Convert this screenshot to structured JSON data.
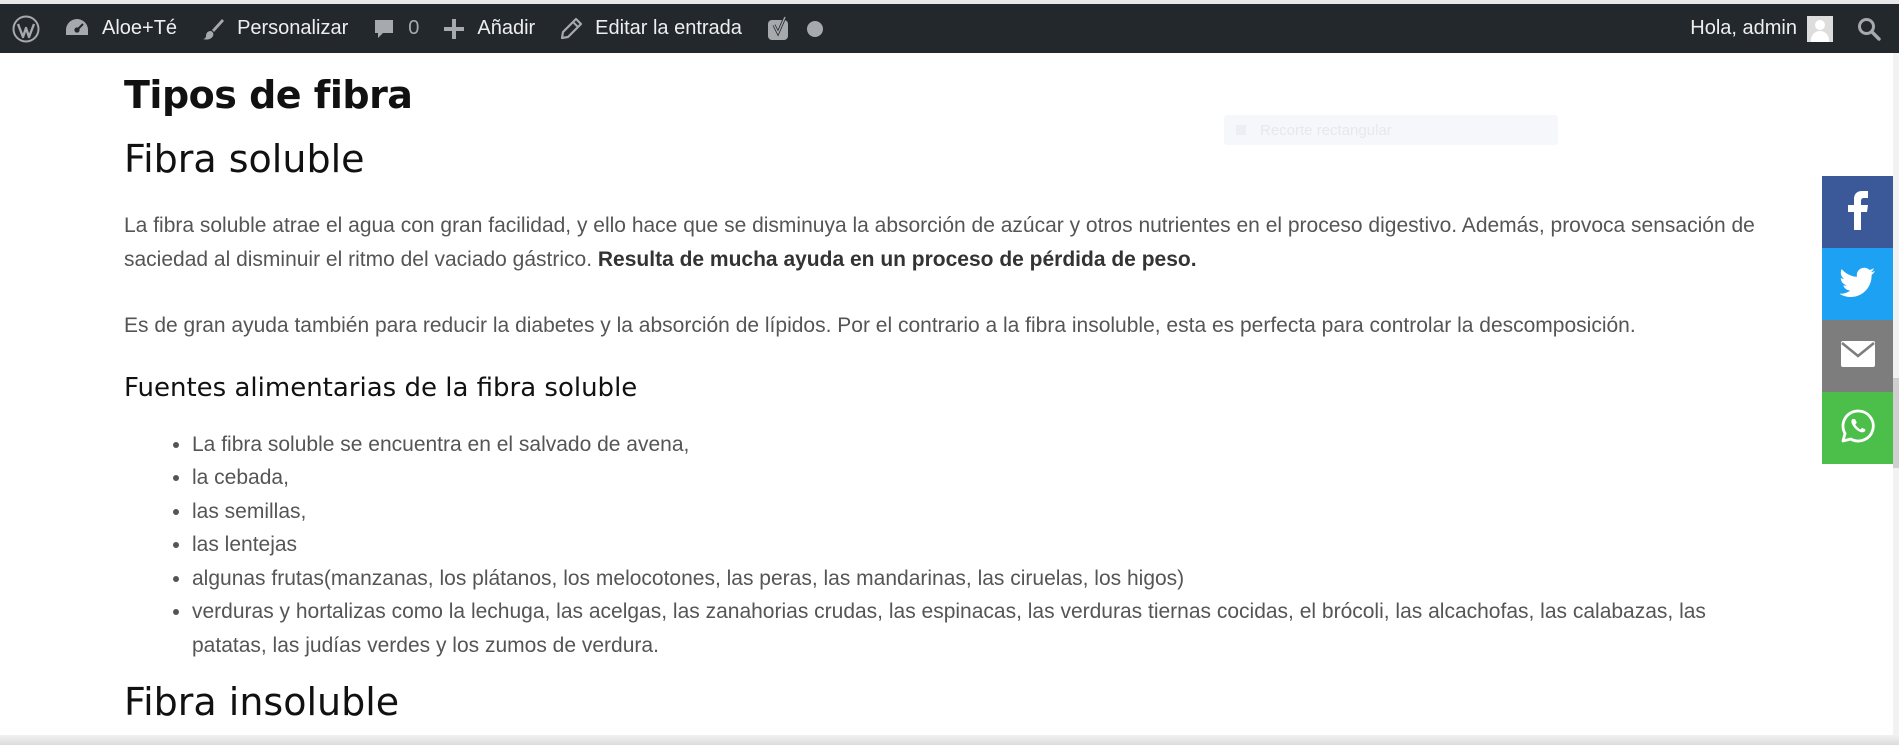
{
  "admin_bar": {
    "site_name": "Aloe+Té",
    "customize": "Personalizar",
    "comments_count": "0",
    "add_new": "Añadir",
    "edit_post": "Editar la entrada",
    "greeting": "Hola, admin",
    "icons": [
      "wordpress-logo-icon",
      "dashboard-icon",
      "brush-icon",
      "comment-icon",
      "plus-icon",
      "pencil-icon",
      "yoast-icon",
      "status-dot-icon",
      "avatar",
      "search-icon"
    ]
  },
  "article": {
    "h_tipos": "Tipos de fibra",
    "h_soluble": "Fibra soluble",
    "p1_text": "La fibra soluble atrae el agua con gran facilidad, y ello hace que se disminuya la absorción de azúcar y otros nutrientes en el proceso digestivo. Además, provoca sensación de saciedad al disminuir el ritmo del vaciado gástrico. ",
    "p1_bold": "Resulta de mucha ayuda en un proceso de pérdida de peso.",
    "p2": "Es de gran ayuda también para reducir la diabetes y la absorción de lípidos. Por el contrario a la fibra insoluble, esta es perfecta para controlar la descomposición.",
    "h_fuentes": "Fuentes alimentarias de la fibra soluble",
    "list": [
      "La fibra soluble se encuentra en el salvado de avena,",
      "la cebada,",
      "las semillas,",
      "las lentejas",
      "algunas frutas(manzanas, los plátanos, los melocotones, las peras, las mandarinas, las ciruelas, los higos)",
      "verduras y hortalizas como la lechuga, las acelgas, las zanahorias crudas, las espinacas, las verduras tiernas cocidas, el brócoli, las alcachofas, las calabazas, las patatas, las judías verdes y los zumos de verdura."
    ],
    "h_insoluble": "Fibra insoluble"
  },
  "ghost_overlay": "Recorte rectangular",
  "share_bar": {
    "icons": [
      "facebook-icon",
      "twitter-icon",
      "email-icon",
      "whatsapp-icon"
    ],
    "colors": {
      "facebook": "#3b5998",
      "twitter": "#1da1f2",
      "email": "#7d7d7d",
      "whatsapp": "#4bbf4a"
    }
  },
  "colors": {
    "admin_bar_bg": "#23282d",
    "heading": "#111111",
    "body_text": "#555555"
  }
}
